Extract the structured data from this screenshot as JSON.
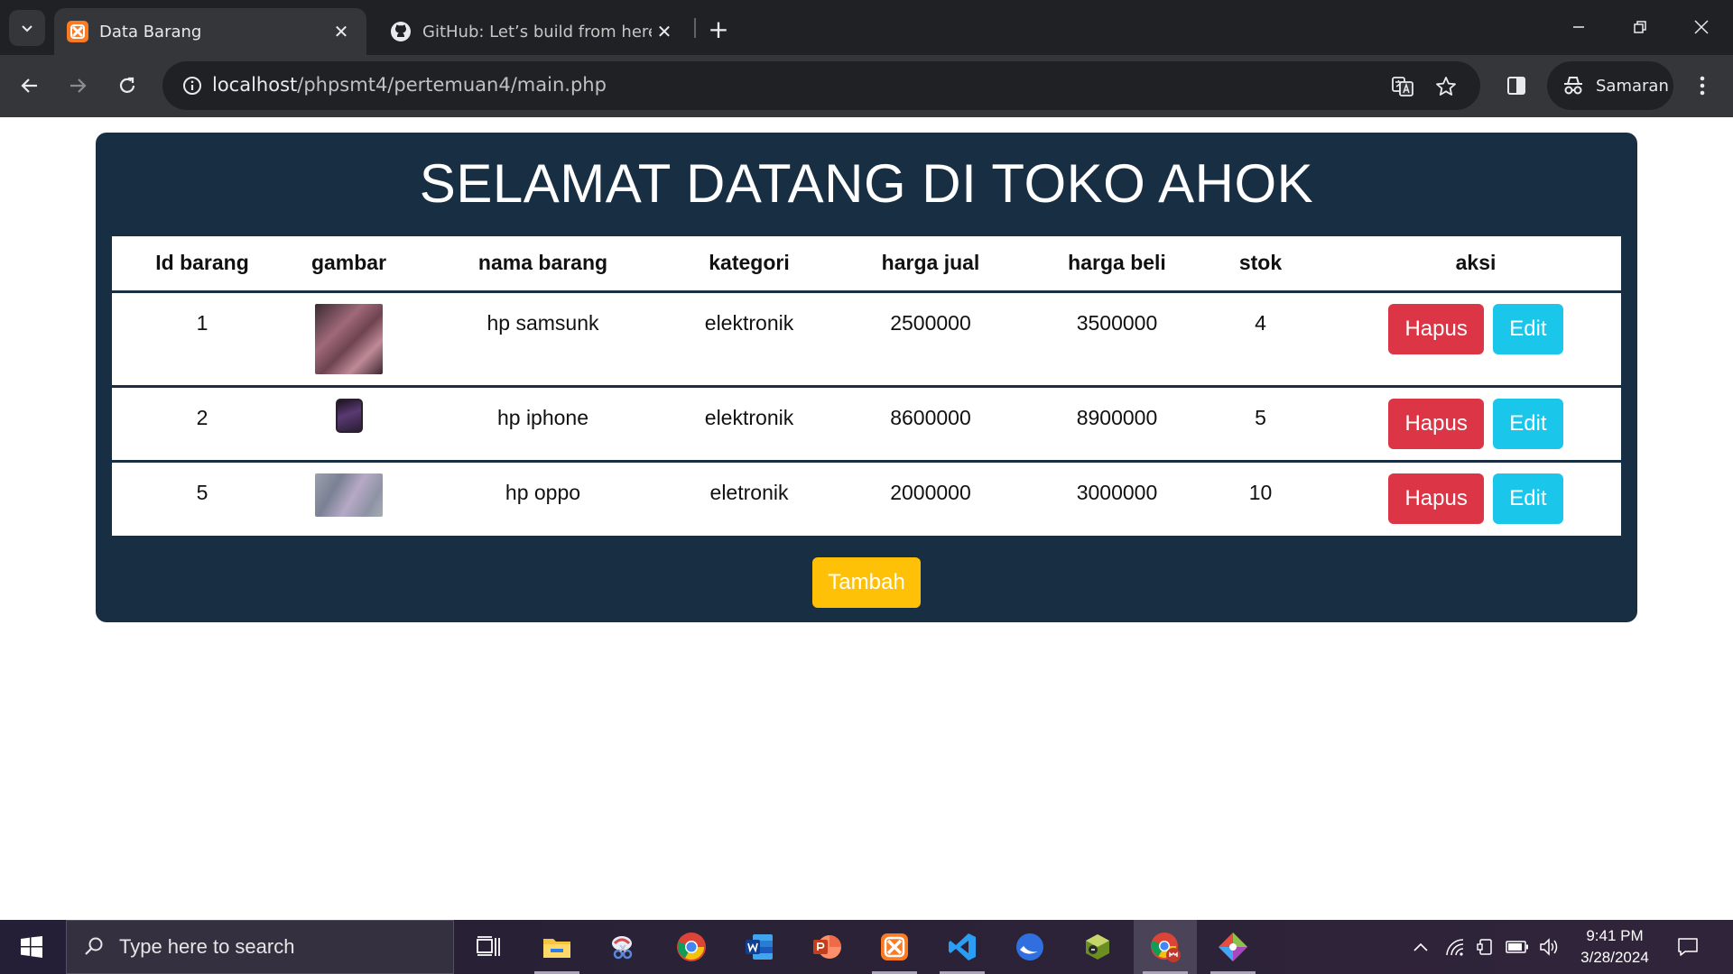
{
  "browser": {
    "tabs": [
      {
        "title": "Data Barang",
        "active": true,
        "favicon": "xampp-icon"
      },
      {
        "title": "GitHub: Let’s build from here · G",
        "active": false,
        "favicon": "github-icon"
      }
    ],
    "address": {
      "host": "localhost",
      "path": "/phpsmt4/pertemuan4/main.php"
    },
    "profile_label": "Samaran"
  },
  "page": {
    "heading": "SELAMAT DATANG DI TOKO AHOK",
    "table": {
      "columns": [
        "Id barang",
        "gambar",
        "nama barang",
        "kategori",
        "harga jual",
        "harga beli",
        "stok",
        "aksi"
      ],
      "rows": [
        {
          "id": "1",
          "image": "samsung-phone-thumbnail",
          "name": "hp samsunk",
          "category": "elektronik",
          "sell_price": "2500000",
          "buy_price": "3500000",
          "stock": "4"
        },
        {
          "id": "2",
          "image": "iphone-thumbnail",
          "name": "hp iphone",
          "category": "elektronik",
          "sell_price": "8600000",
          "buy_price": "8900000",
          "stock": "5"
        },
        {
          "id": "5",
          "image": "oppo-phone-thumbnail",
          "name": "hp oppo",
          "category": "eletronik",
          "sell_price": "2000000",
          "buy_price": "3000000",
          "stock": "10"
        }
      ],
      "delete_label": "Hapus",
      "edit_label": "Edit"
    },
    "add_label": "Tambah",
    "colors": {
      "panel": "#182e43",
      "danger": "#dc3545",
      "info": "#1ac6ea",
      "warning": "#ffc107"
    }
  },
  "taskbar": {
    "search_placeholder": "Type here to search",
    "time": "9:41 PM",
    "date": "3/28/2024"
  }
}
